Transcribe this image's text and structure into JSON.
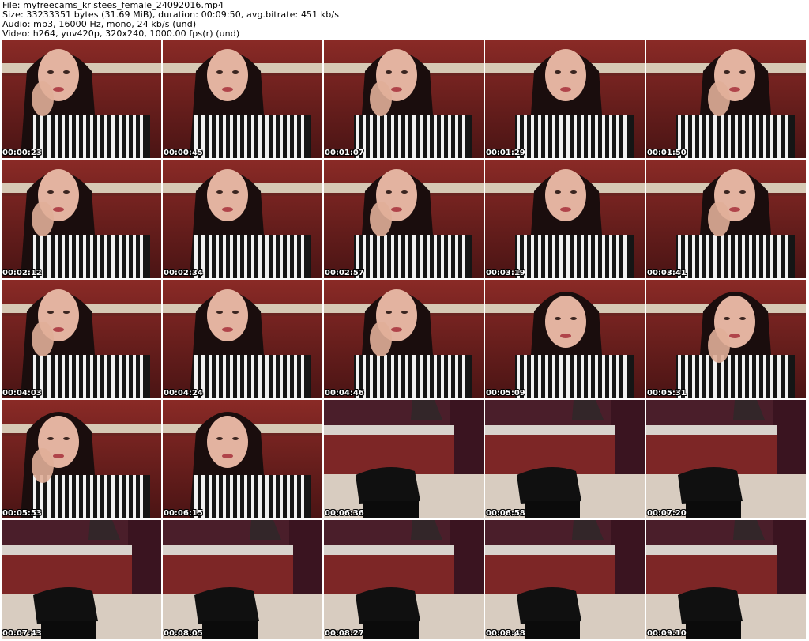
{
  "header": {
    "file_line": "File: myfreecams_kristees_female_24092016.mp4",
    "size_line": "Size: 33233351 bytes (31.69 MiB), duration: 00:09:50, avg.bitrate: 451 kb/s",
    "audio_line": "Audio: mp3, 16000 Hz, mono, 24 kb/s (und)",
    "video_line": "Video: h264, yuv420p, 320x240, 1000.00 fps(r) (und)"
  },
  "frames": [
    {
      "timestamp": "00:00:23",
      "scene": "person"
    },
    {
      "timestamp": "00:00:45",
      "scene": "person"
    },
    {
      "timestamp": "00:01:07",
      "scene": "person"
    },
    {
      "timestamp": "00:01:29",
      "scene": "person"
    },
    {
      "timestamp": "00:01:50",
      "scene": "person"
    },
    {
      "timestamp": "00:02:12",
      "scene": "person"
    },
    {
      "timestamp": "00:02:34",
      "scene": "person"
    },
    {
      "timestamp": "00:02:57",
      "scene": "person"
    },
    {
      "timestamp": "00:03:19",
      "scene": "person"
    },
    {
      "timestamp": "00:03:41",
      "scene": "person"
    },
    {
      "timestamp": "00:04:03",
      "scene": "person"
    },
    {
      "timestamp": "00:04:24",
      "scene": "person"
    },
    {
      "timestamp": "00:04:46",
      "scene": "person"
    },
    {
      "timestamp": "00:05:09",
      "scene": "person"
    },
    {
      "timestamp": "00:05:31",
      "scene": "person"
    },
    {
      "timestamp": "00:05:53",
      "scene": "person"
    },
    {
      "timestamp": "00:06:15",
      "scene": "person"
    },
    {
      "timestamp": "00:06:36",
      "scene": "empty-room"
    },
    {
      "timestamp": "00:06:58",
      "scene": "empty-room"
    },
    {
      "timestamp": "00:07:20",
      "scene": "empty-room"
    },
    {
      "timestamp": "00:07:43",
      "scene": "empty-room"
    },
    {
      "timestamp": "00:08:05",
      "scene": "empty-room"
    },
    {
      "timestamp": "00:08:27",
      "scene": "empty-room"
    },
    {
      "timestamp": "00:08:48",
      "scene": "empty-room"
    },
    {
      "timestamp": "00:09:10",
      "scene": "empty-room"
    }
  ]
}
